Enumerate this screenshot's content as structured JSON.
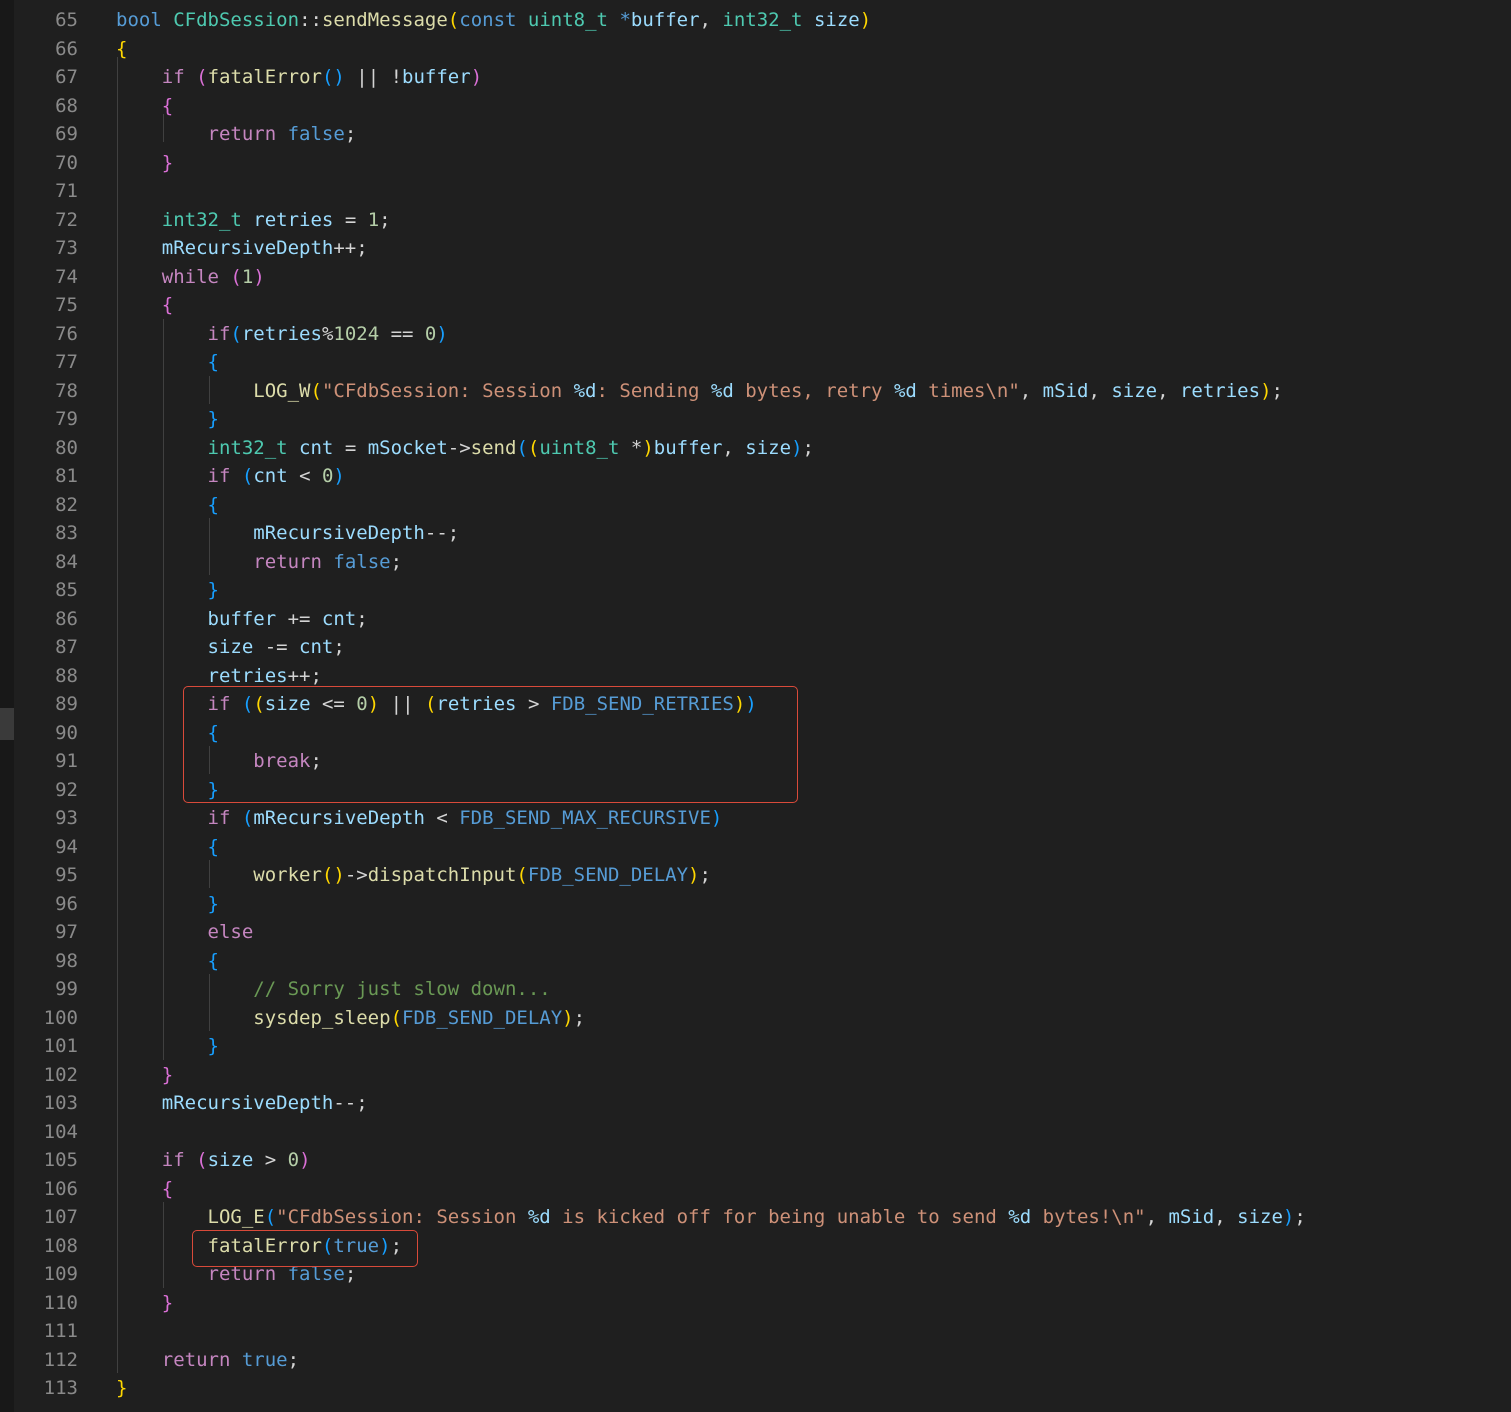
{
  "gutter": {
    "line_numbers": [
      "65",
      "66",
      "67",
      "68",
      "69",
      "70",
      "71",
      "72",
      "73",
      "74",
      "75",
      "76",
      "77",
      "78",
      "79",
      "80",
      "81",
      "82",
      "83",
      "84",
      "85",
      "86",
      "87",
      "88",
      "89",
      "90",
      "91",
      "92",
      "93",
      "94",
      "95",
      "96",
      "97",
      "98",
      "99",
      "100",
      "101",
      "102",
      "103",
      "104",
      "105",
      "106",
      "107",
      "108",
      "109",
      "110",
      "111",
      "112",
      "113"
    ]
  },
  "colors": {
    "background": "#1f1f1f",
    "line_number": "#8a8a8a",
    "keyword": "#569cd6",
    "control": "#c586c0",
    "type": "#4ec9b0",
    "function": "#dcdcaa",
    "variable": "#9cdcfe",
    "number": "#b5cea8",
    "string": "#ce9178",
    "comment": "#6a9955",
    "bracket_level1": "#ffd700",
    "bracket_level2": "#da70d6",
    "bracket_level3": "#179fff",
    "highlight_box": "#d94a3a"
  },
  "code_lines": [
    [
      [
        "t-kw",
        "bool"
      ],
      [
        "t-op",
        " "
      ],
      [
        "t-type",
        "CFdbSession"
      ],
      [
        "t-op",
        "::"
      ],
      [
        "t-fn",
        "sendMessage"
      ],
      [
        "t-b1",
        "("
      ],
      [
        "t-kw",
        "const"
      ],
      [
        "t-op",
        " "
      ],
      [
        "t-type",
        "uint8_t"
      ],
      [
        "t-op",
        " "
      ],
      [
        "t-kw",
        "*"
      ],
      [
        "t-var",
        "buffer"
      ],
      [
        "t-op",
        ", "
      ],
      [
        "t-type",
        "int32_t"
      ],
      [
        "t-op",
        " "
      ],
      [
        "t-var",
        "size"
      ],
      [
        "t-b1",
        ")"
      ]
    ],
    [
      [
        "t-b1",
        "{"
      ]
    ],
    [
      [
        "t-op",
        "    "
      ],
      [
        "t-ctrl",
        "if"
      ],
      [
        "t-op",
        " "
      ],
      [
        "t-b2",
        "("
      ],
      [
        "t-fn",
        "fatalError"
      ],
      [
        "t-b3",
        "()"
      ],
      [
        "t-op",
        " || !"
      ],
      [
        "t-var",
        "buffer"
      ],
      [
        "t-b2",
        ")"
      ]
    ],
    [
      [
        "t-op",
        "    "
      ],
      [
        "t-b2",
        "{"
      ]
    ],
    [
      [
        "t-op",
        "        "
      ],
      [
        "t-ctrl",
        "return"
      ],
      [
        "t-op",
        " "
      ],
      [
        "t-kw",
        "false"
      ],
      [
        "t-op",
        ";"
      ]
    ],
    [
      [
        "t-op",
        "    "
      ],
      [
        "t-b2",
        "}"
      ]
    ],
    [],
    [
      [
        "t-op",
        "    "
      ],
      [
        "t-type",
        "int32_t"
      ],
      [
        "t-op",
        " "
      ],
      [
        "t-var",
        "retries"
      ],
      [
        "t-op",
        " = "
      ],
      [
        "t-num",
        "1"
      ],
      [
        "t-op",
        ";"
      ]
    ],
    [
      [
        "t-op",
        "    "
      ],
      [
        "t-var",
        "mRecursiveDepth"
      ],
      [
        "t-op",
        "++;"
      ]
    ],
    [
      [
        "t-op",
        "    "
      ],
      [
        "t-ctrl",
        "while"
      ],
      [
        "t-op",
        " "
      ],
      [
        "t-b2",
        "("
      ],
      [
        "t-num",
        "1"
      ],
      [
        "t-b2",
        ")"
      ]
    ],
    [
      [
        "t-op",
        "    "
      ],
      [
        "t-b2",
        "{"
      ]
    ],
    [
      [
        "t-op",
        "        "
      ],
      [
        "t-ctrl",
        "if"
      ],
      [
        "t-b3",
        "("
      ],
      [
        "t-var",
        "retries"
      ],
      [
        "t-op",
        "%"
      ],
      [
        "t-num",
        "1024"
      ],
      [
        "t-op",
        " == "
      ],
      [
        "t-num",
        "0"
      ],
      [
        "t-b3",
        ")"
      ]
    ],
    [
      [
        "t-op",
        "        "
      ],
      [
        "t-b3",
        "{"
      ]
    ],
    [
      [
        "t-op",
        "            "
      ],
      [
        "t-fn",
        "LOG_W"
      ],
      [
        "t-b1",
        "("
      ],
      [
        "t-str",
        "\"CFdbSession: Session "
      ],
      [
        "t-fmt",
        "%d"
      ],
      [
        "t-str",
        ": Sending "
      ],
      [
        "t-fmt",
        "%d"
      ],
      [
        "t-str",
        " bytes, retry "
      ],
      [
        "t-fmt",
        "%d"
      ],
      [
        "t-str",
        " times\\n\""
      ],
      [
        "t-op",
        ", "
      ],
      [
        "t-var",
        "mSid"
      ],
      [
        "t-op",
        ", "
      ],
      [
        "t-var",
        "size"
      ],
      [
        "t-op",
        ", "
      ],
      [
        "t-var",
        "retries"
      ],
      [
        "t-b1",
        ")"
      ],
      [
        "t-op",
        ";"
      ]
    ],
    [
      [
        "t-op",
        "        "
      ],
      [
        "t-b3",
        "}"
      ]
    ],
    [
      [
        "t-op",
        "        "
      ],
      [
        "t-type",
        "int32_t"
      ],
      [
        "t-op",
        " "
      ],
      [
        "t-var",
        "cnt"
      ],
      [
        "t-op",
        " = "
      ],
      [
        "t-var",
        "mSocket"
      ],
      [
        "t-op",
        "->"
      ],
      [
        "t-fn",
        "send"
      ],
      [
        "t-b3",
        "("
      ],
      [
        "t-b1",
        "("
      ],
      [
        "t-type",
        "uint8_t"
      ],
      [
        "t-op",
        " *"
      ],
      [
        "t-b1",
        ")"
      ],
      [
        "t-var",
        "buffer"
      ],
      [
        "t-op",
        ", "
      ],
      [
        "t-var",
        "size"
      ],
      [
        "t-b3",
        ")"
      ],
      [
        "t-op",
        ";"
      ]
    ],
    [
      [
        "t-op",
        "        "
      ],
      [
        "t-ctrl",
        "if"
      ],
      [
        "t-op",
        " "
      ],
      [
        "t-b3",
        "("
      ],
      [
        "t-var",
        "cnt"
      ],
      [
        "t-op",
        " < "
      ],
      [
        "t-num",
        "0"
      ],
      [
        "t-b3",
        ")"
      ]
    ],
    [
      [
        "t-op",
        "        "
      ],
      [
        "t-b3",
        "{"
      ]
    ],
    [
      [
        "t-op",
        "            "
      ],
      [
        "t-var",
        "mRecursiveDepth"
      ],
      [
        "t-op",
        "--;"
      ]
    ],
    [
      [
        "t-op",
        "            "
      ],
      [
        "t-ctrl",
        "return"
      ],
      [
        "t-op",
        " "
      ],
      [
        "t-kw",
        "false"
      ],
      [
        "t-op",
        ";"
      ]
    ],
    [
      [
        "t-op",
        "        "
      ],
      [
        "t-b3",
        "}"
      ]
    ],
    [
      [
        "t-op",
        "        "
      ],
      [
        "t-var",
        "buffer"
      ],
      [
        "t-op",
        " += "
      ],
      [
        "t-var",
        "cnt"
      ],
      [
        "t-op",
        ";"
      ]
    ],
    [
      [
        "t-op",
        "        "
      ],
      [
        "t-var",
        "size"
      ],
      [
        "t-op",
        " -= "
      ],
      [
        "t-var",
        "cnt"
      ],
      [
        "t-op",
        ";"
      ]
    ],
    [
      [
        "t-op",
        "        "
      ],
      [
        "t-var",
        "retries"
      ],
      [
        "t-op",
        "++;"
      ]
    ],
    [
      [
        "t-op",
        "        "
      ],
      [
        "t-ctrl",
        "if"
      ],
      [
        "t-op",
        " "
      ],
      [
        "t-b3",
        "("
      ],
      [
        "t-b1",
        "("
      ],
      [
        "t-var",
        "size"
      ],
      [
        "t-op",
        " <= "
      ],
      [
        "t-num",
        "0"
      ],
      [
        "t-b1",
        ")"
      ],
      [
        "t-op",
        " || "
      ],
      [
        "t-b1",
        "("
      ],
      [
        "t-var",
        "retries"
      ],
      [
        "t-op",
        " > "
      ],
      [
        "t-mac",
        "FDB_SEND_RETRIES"
      ],
      [
        "t-b1",
        ")"
      ],
      [
        "t-b3",
        ")"
      ]
    ],
    [
      [
        "t-op",
        "        "
      ],
      [
        "t-b3",
        "{"
      ]
    ],
    [
      [
        "t-op",
        "            "
      ],
      [
        "t-ctrl",
        "break"
      ],
      [
        "t-op",
        ";"
      ]
    ],
    [
      [
        "t-op",
        "        "
      ],
      [
        "t-b3",
        "}"
      ]
    ],
    [
      [
        "t-op",
        "        "
      ],
      [
        "t-ctrl",
        "if"
      ],
      [
        "t-op",
        " "
      ],
      [
        "t-b3",
        "("
      ],
      [
        "t-var",
        "mRecursiveDepth"
      ],
      [
        "t-op",
        " < "
      ],
      [
        "t-mac",
        "FDB_SEND_MAX_RECURSIVE"
      ],
      [
        "t-b3",
        ")"
      ]
    ],
    [
      [
        "t-op",
        "        "
      ],
      [
        "t-b3",
        "{"
      ]
    ],
    [
      [
        "t-op",
        "            "
      ],
      [
        "t-fn",
        "worker"
      ],
      [
        "t-b1",
        "()"
      ],
      [
        "t-op",
        "->"
      ],
      [
        "t-fn",
        "dispatchInput"
      ],
      [
        "t-b1",
        "("
      ],
      [
        "t-mac",
        "FDB_SEND_DELAY"
      ],
      [
        "t-b1",
        ")"
      ],
      [
        "t-op",
        ";"
      ]
    ],
    [
      [
        "t-op",
        "        "
      ],
      [
        "t-b3",
        "}"
      ]
    ],
    [
      [
        "t-op",
        "        "
      ],
      [
        "t-ctrl",
        "else"
      ]
    ],
    [
      [
        "t-op",
        "        "
      ],
      [
        "t-b3",
        "{"
      ]
    ],
    [
      [
        "t-op",
        "            "
      ],
      [
        "t-com",
        "// Sorry just slow down..."
      ]
    ],
    [
      [
        "t-op",
        "            "
      ],
      [
        "t-fn",
        "sysdep_sleep"
      ],
      [
        "t-b1",
        "("
      ],
      [
        "t-mac",
        "FDB_SEND_DELAY"
      ],
      [
        "t-b1",
        ")"
      ],
      [
        "t-op",
        ";"
      ]
    ],
    [
      [
        "t-op",
        "        "
      ],
      [
        "t-b3",
        "}"
      ]
    ],
    [
      [
        "t-op",
        "    "
      ],
      [
        "t-b2",
        "}"
      ]
    ],
    [
      [
        "t-op",
        "    "
      ],
      [
        "t-var",
        "mRecursiveDepth"
      ],
      [
        "t-op",
        "--;"
      ]
    ],
    [],
    [
      [
        "t-op",
        "    "
      ],
      [
        "t-ctrl",
        "if"
      ],
      [
        "t-op",
        " "
      ],
      [
        "t-b2",
        "("
      ],
      [
        "t-var",
        "size"
      ],
      [
        "t-op",
        " > "
      ],
      [
        "t-num",
        "0"
      ],
      [
        "t-b2",
        ")"
      ]
    ],
    [
      [
        "t-op",
        "    "
      ],
      [
        "t-b2",
        "{"
      ]
    ],
    [
      [
        "t-op",
        "        "
      ],
      [
        "t-fn",
        "LOG_E"
      ],
      [
        "t-b3",
        "("
      ],
      [
        "t-str",
        "\"CFdbSession: Session "
      ],
      [
        "t-fmt",
        "%d"
      ],
      [
        "t-str",
        " is kicked off for being unable to send "
      ],
      [
        "t-fmt",
        "%d"
      ],
      [
        "t-str",
        " bytes!\\n\""
      ],
      [
        "t-op",
        ", "
      ],
      [
        "t-var",
        "mSid"
      ],
      [
        "t-op",
        ", "
      ],
      [
        "t-var",
        "size"
      ],
      [
        "t-b3",
        ")"
      ],
      [
        "t-op",
        ";"
      ]
    ],
    [
      [
        "t-op",
        "        "
      ],
      [
        "t-fn",
        "fatalError"
      ],
      [
        "t-b3",
        "("
      ],
      [
        "t-kw",
        "true"
      ],
      [
        "t-b3",
        ")"
      ],
      [
        "t-op",
        ";"
      ]
    ],
    [
      [
        "t-op",
        "        "
      ],
      [
        "t-ctrl",
        "return"
      ],
      [
        "t-op",
        " "
      ],
      [
        "t-kw",
        "false"
      ],
      [
        "t-op",
        ";"
      ]
    ],
    [
      [
        "t-op",
        "    "
      ],
      [
        "t-b2",
        "}"
      ]
    ],
    [],
    [
      [
        "t-op",
        "    "
      ],
      [
        "t-ctrl",
        "return"
      ],
      [
        "t-op",
        " "
      ],
      [
        "t-kw",
        "true"
      ],
      [
        "t-op",
        ";"
      ]
    ],
    [
      [
        "t-b1",
        "}"
      ]
    ]
  ]
}
